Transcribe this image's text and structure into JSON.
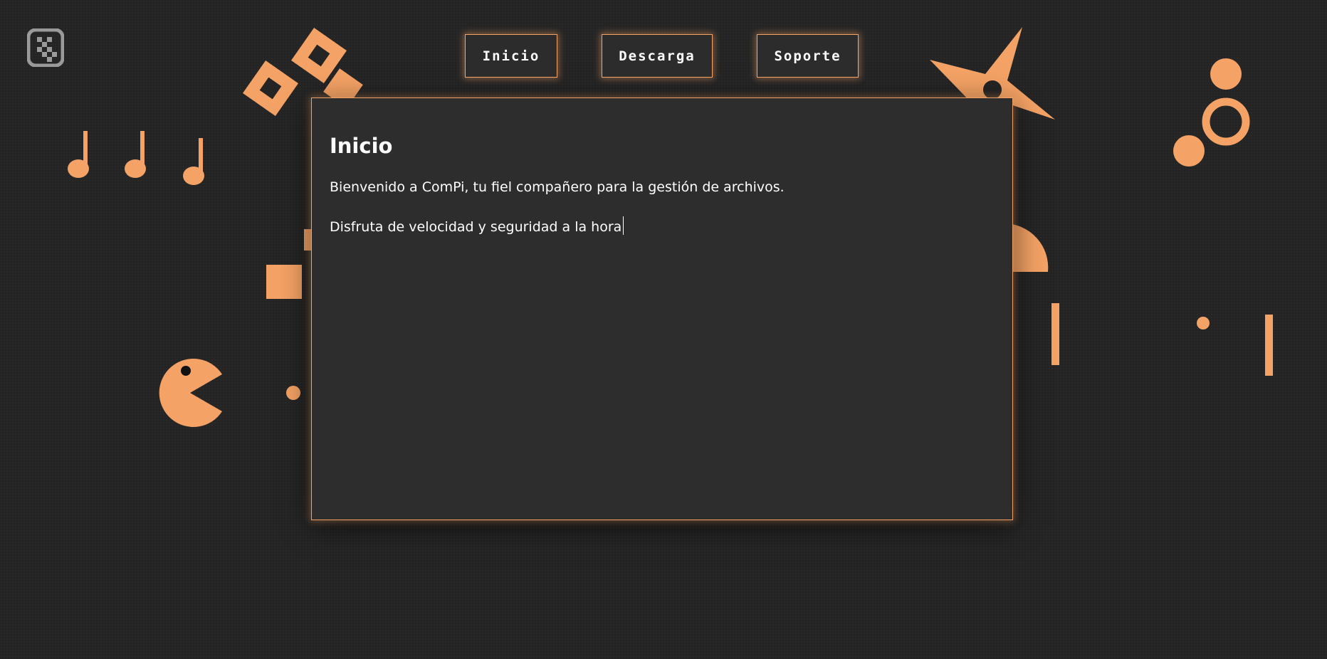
{
  "colors": {
    "accent": "#f4a265",
    "background": "#242424",
    "panel": "#2d2d2d",
    "text": "#ffffff",
    "logo": "#9a9a9a"
  },
  "nav": {
    "items": [
      {
        "label": "Inicio"
      },
      {
        "label": "Descarga"
      },
      {
        "label": "Soporte"
      }
    ]
  },
  "main": {
    "title": "Inicio",
    "paragraphs": [
      "Bienvenido a ComPi, tu fiel compañero para la gestión de archivos.",
      "Disfruta de velocidad y seguridad a la hora"
    ]
  },
  "icons": {
    "logo": "app-logo-icon",
    "music_notes": "music-note-icon",
    "pacman": "pacman-icon",
    "star": "star-icon"
  }
}
